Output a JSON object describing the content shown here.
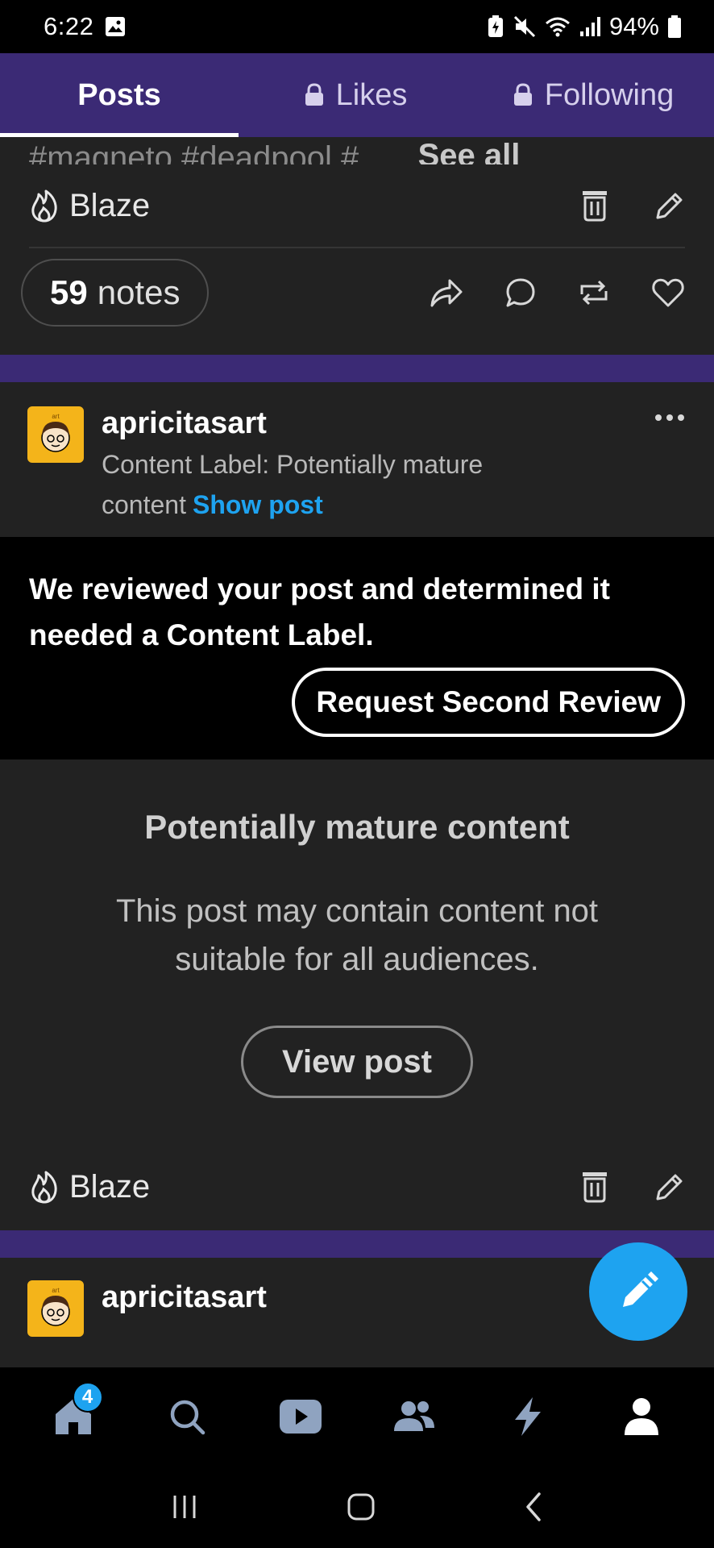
{
  "status_bar": {
    "time": "6:22",
    "battery": "94%",
    "icons": [
      "image-icon",
      "battery-saver-icon",
      "mute-icon",
      "wifi-icon",
      "signal-icon",
      "battery-icon"
    ]
  },
  "tabs": [
    {
      "label": "Posts",
      "active": true,
      "locked": false
    },
    {
      "label": "Likes",
      "active": false,
      "locked": true
    },
    {
      "label": "Following",
      "active": false,
      "locked": true
    }
  ],
  "post1": {
    "tags": "#magneto  #deadpool  #...",
    "see_all": "See all",
    "blaze_label": "Blaze",
    "notes_count": "59",
    "notes_label": "notes"
  },
  "post2": {
    "username": "apricitasart",
    "content_label": "Content Label: Potentially mature content",
    "show_post": "Show post",
    "review_message": "We reviewed your post and determined it needed a Content Label.",
    "review_button": "Request Second Review",
    "mature_title": "Potentially mature content",
    "mature_desc": "This post may contain content not suitable for all audiences.",
    "view_post": "View post",
    "blaze_label": "Blaze"
  },
  "post3": {
    "username": "apricitasart"
  },
  "bottom_nav": {
    "items": [
      "home-icon",
      "search-icon",
      "video-icon",
      "community-icon",
      "activity-icon",
      "account-icon"
    ],
    "home_badge": "4"
  },
  "colors": {
    "accent_purple": "#3b2a75",
    "blue": "#1ea3f0",
    "card_bg": "#222222"
  }
}
